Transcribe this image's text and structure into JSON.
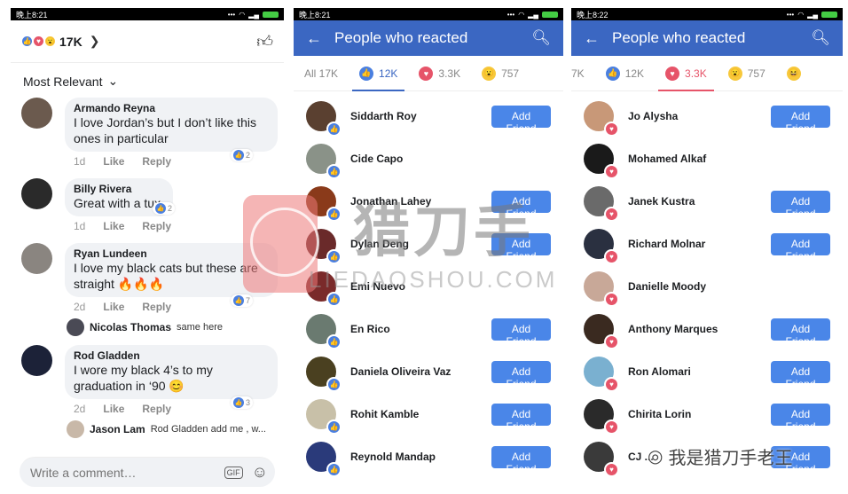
{
  "panel1": {
    "status_time": "晚上8:21",
    "reaction_total": "17K",
    "sort_label": "Most Relevant",
    "comments": [
      {
        "name": "Armando Reyna",
        "text": "I love Jordan’s but I don’t like this ones in particular",
        "age": "1d",
        "like": "Like",
        "reply": "Reply",
        "likes": "2",
        "avatar_color": "#6b5a4e"
      },
      {
        "name": "Billy Rivera",
        "text": "Great with a tux.",
        "age": "1d",
        "like": "Like",
        "reply": "Reply",
        "likes": "2",
        "avatar_color": "#2a2a2a"
      },
      {
        "name": "Ryan Lundeen",
        "text": "I love my black cats but these are straight 🔥🔥🔥",
        "age": "2d",
        "like": "Like",
        "reply": "Reply",
        "likes": "7",
        "avatar_color": "#8a8580",
        "reply_preview": {
          "name": "Nicolas Thomas",
          "text": "same here",
          "avatar_color": "#4a4a55"
        }
      },
      {
        "name": "Rod Gladden",
        "text": "I wore my black 4’s to my graduation in ‘90 😊",
        "age": "2d",
        "like": "Like",
        "reply": "Reply",
        "likes": "3",
        "avatar_color": "#1c2238",
        "reply_preview": {
          "name": "Jason Lam",
          "text": "Rod Gladden add me , w...",
          "avatar_color": "#c8b8a8"
        }
      }
    ],
    "composer_placeholder": "Write a comment…",
    "gif_label": "GIF"
  },
  "panel2": {
    "status_time": "晚上8:21",
    "title": "People who reacted",
    "tabs": [
      {
        "label": "All 17K",
        "icon": ""
      },
      {
        "label": "12K",
        "icon": "like"
      },
      {
        "label": "3.3K",
        "icon": "love"
      },
      {
        "label": "757",
        "icon": "wow"
      }
    ],
    "people": [
      {
        "name": "Siddarth Roy",
        "button": "Add Friend",
        "avatar_color": "#5a4030"
      },
      {
        "name": "Cide Capo",
        "button": "",
        "avatar_color": "#8a9288"
      },
      {
        "name": "Jonathan Lahey",
        "button": "Add Friend",
        "avatar_color": "#8a3a1a"
      },
      {
        "name": "Dylan Deng",
        "button": "Add Friend",
        "avatar_color": "#6a2a2a"
      },
      {
        "name": "Emi Nuevo",
        "button": "",
        "avatar_color": "#7a2a2a"
      },
      {
        "name": "En Rico",
        "button": "Add Friend",
        "avatar_color": "#6a7a70"
      },
      {
        "name": "Daniela Oliveira Vaz",
        "button": "Add Friend",
        "avatar_color": "#4a4020"
      },
      {
        "name": "Rohit Kamble",
        "button": "Add Friend",
        "avatar_color": "#c8c0a8"
      },
      {
        "name": "Reynold Mandap",
        "button": "Add Friend",
        "avatar_color": "#2a3a7a"
      }
    ]
  },
  "panel3": {
    "status_time": "晚上8:22",
    "title": "People who reacted",
    "tabs": [
      {
        "label": "7K",
        "icon": ""
      },
      {
        "label": "12K",
        "icon": "like"
      },
      {
        "label": "3.3K",
        "icon": "love"
      },
      {
        "label": "757",
        "icon": "wow"
      },
      {
        "label": "",
        "icon": "haha"
      }
    ],
    "people": [
      {
        "name": "Jo Alysha",
        "button": "Add Friend",
        "avatar_color": "#c89878"
      },
      {
        "name": "Mohamed Alkaf",
        "button": "",
        "avatar_color": "#1a1a1a"
      },
      {
        "name": "Janek Kustra",
        "button": "Add Friend",
        "avatar_color": "#6a6a6a"
      },
      {
        "name": "Richard Molnar",
        "button": "Add Friend",
        "avatar_color": "#2a3040"
      },
      {
        "name": "Danielle Moody",
        "button": "",
        "avatar_color": "#c8a898"
      },
      {
        "name": "Anthony Marques",
        "button": "Add Friend",
        "avatar_color": "#3a2a20"
      },
      {
        "name": "Ron Alomari",
        "button": "Add Friend",
        "avatar_color": "#7ab0d0"
      },
      {
        "name": "Chirita Lorin",
        "button": "Add Friend",
        "avatar_color": "#2a2a2a"
      },
      {
        "name": "CJ ...",
        "button": "Add Friend",
        "avatar_color": "#3a3a3a"
      }
    ]
  },
  "watermark": {
    "brand": "猎刀手",
    "domain": "LIEDAOSHOU.COM",
    "signature": "我是猎刀手老王"
  },
  "colors": {
    "fb_blue": "#3b67c2",
    "button_blue": "#4a86e8",
    "love_red": "#e65469",
    "wow_yellow": "#f7c83b"
  }
}
